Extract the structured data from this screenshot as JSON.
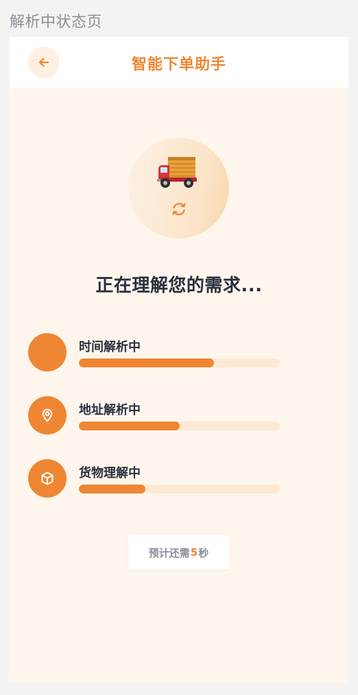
{
  "page_label": "解析中状态页",
  "header": {
    "title": "智能下单助手"
  },
  "main": {
    "title": "正在理解您的需求..."
  },
  "steps": [
    {
      "label": "时间解析中",
      "progress": 0.67,
      "icon": "blank-icon"
    },
    {
      "label": "地址解析中",
      "progress": 0.5,
      "icon": "location-pin-icon"
    },
    {
      "label": "货物理解中",
      "progress": 0.33,
      "icon": "package-box-icon"
    }
  ],
  "eta": {
    "prefix": "预计还需",
    "seconds": "5",
    "suffix": "秒"
  },
  "colors": {
    "accent": "#ef8633",
    "background": "#fef6ec",
    "track": "#fde9d3",
    "text": "#2a2f3e"
  }
}
